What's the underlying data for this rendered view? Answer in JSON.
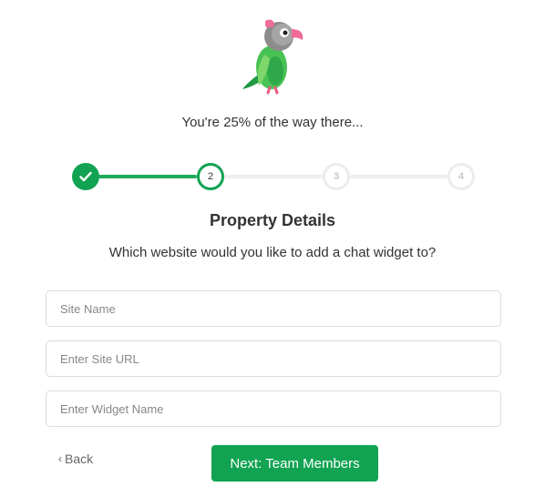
{
  "mascot": {
    "icon": "parrot-icon"
  },
  "progress": {
    "text": "You're 25% of the way there...",
    "percent": 25
  },
  "stepper": {
    "steps": [
      {
        "label": "",
        "state": "complete",
        "icon": "check-icon"
      },
      {
        "label": "2",
        "state": "current"
      },
      {
        "label": "3",
        "state": "upcoming"
      },
      {
        "label": "4",
        "state": "upcoming"
      }
    ]
  },
  "form": {
    "title": "Property Details",
    "subtitle": "Which website would you like to add a chat widget to?",
    "site_name": {
      "value": "",
      "placeholder": "Site Name"
    },
    "site_url": {
      "value": "",
      "placeholder": "Enter Site URL"
    },
    "widget_name": {
      "value": "",
      "placeholder": "Enter Widget Name"
    }
  },
  "actions": {
    "back_label": "Back",
    "back_icon": "chevron-left-icon",
    "next_label": "Next: Team Members"
  },
  "colors": {
    "primary": "#11a352",
    "inactive": "#eeeeee",
    "text": "#333333"
  }
}
